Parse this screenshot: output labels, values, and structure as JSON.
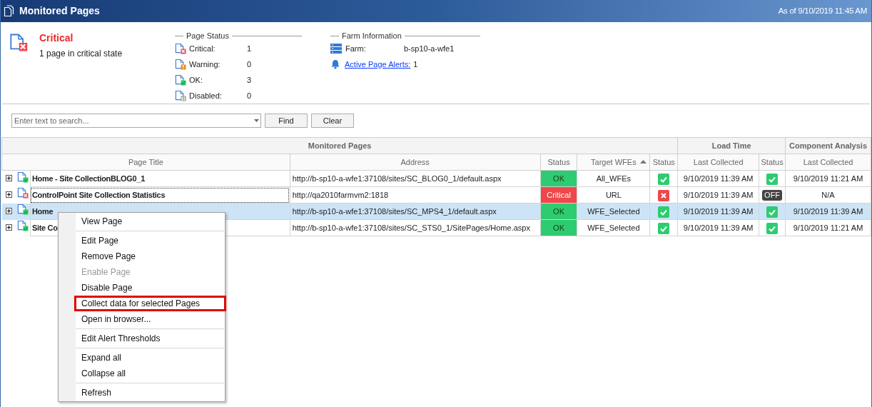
{
  "window": {
    "title": "Monitored Pages",
    "timestamp": "As of 9/10/2019 11:45 AM"
  },
  "summary": {
    "kind": "critical",
    "state": "Critical",
    "message": "1 page in critical state"
  },
  "page_status": {
    "title": "Page Status",
    "items": [
      {
        "kind": "critical",
        "label": "Critical:",
        "count": "1"
      },
      {
        "kind": "warning",
        "label": "Warning:",
        "count": "0"
      },
      {
        "kind": "ok",
        "label": "OK:",
        "count": "3"
      },
      {
        "kind": "disabled",
        "label": "Disabled:",
        "count": "0"
      }
    ]
  },
  "farm_information": {
    "title": "Farm Information",
    "farm_label": "Farm:",
    "farm_value": "b-sp10-a-wfe1",
    "alerts_link": "Active Page Alerts:",
    "alerts_count": "1"
  },
  "search": {
    "placeholder": "Enter text to search...",
    "buttons": [
      "Find",
      "Clear"
    ]
  },
  "table": {
    "group_headers": [
      "Monitored Pages",
      "Load Time",
      "Component Analysis"
    ],
    "columns": [
      {
        "label": "Page Title",
        "sorted": false
      },
      {
        "label": "Address",
        "sorted": false
      },
      {
        "label": "Status",
        "sorted": false
      },
      {
        "label": "Target WFEs",
        "sorted": true
      },
      {
        "label": "Status",
        "sorted": false
      },
      {
        "label": "Last Collected",
        "sorted": false
      },
      {
        "label": "Status",
        "sorted": false
      },
      {
        "label": "Last Collected",
        "sorted": false
      }
    ],
    "rows": [
      {
        "selected": false,
        "focused": false,
        "page_icon": {
          "kind": "ok"
        },
        "title": "Home - Site CollectionBLOG0_1",
        "address": "http://b-sp10-a-wfe1:37108/sites/SC_BLOG0_1/default.aspx",
        "status": {
          "kind": "ok",
          "text": "OK"
        },
        "target": "All_WFEs",
        "load_status": {
          "kind": "ok"
        },
        "load_last": "9/10/2019 11:39 AM",
        "component_status": {
          "kind": "ok"
        },
        "component_last": "9/10/2019 11:21 AM"
      },
      {
        "selected": false,
        "focused": true,
        "page_icon": {
          "kind": "critical"
        },
        "title": "ControlPoint Site Collection Statistics",
        "address": "http://qa2010farmvm2:1818",
        "status": {
          "kind": "critical",
          "text": "Critical"
        },
        "target": "URL",
        "load_status": {
          "kind": "error"
        },
        "load_last": "9/10/2019 11:39 AM",
        "component_status": {
          "kind": "off",
          "text": "OFF"
        },
        "component_last": "N/A"
      },
      {
        "selected": true,
        "focused": false,
        "page_icon": {
          "kind": "ok"
        },
        "title": "Home",
        "address": "http://b-sp10-a-wfe1:37108/sites/SC_MPS4_1/default.aspx",
        "status": {
          "kind": "ok",
          "text": "OK"
        },
        "target": "WFE_Selected",
        "load_status": {
          "kind": "ok"
        },
        "load_last": "9/10/2019 11:39 AM",
        "component_status": {
          "kind": "ok"
        },
        "component_last": "9/10/2019 11:39 AM"
      },
      {
        "selected": false,
        "focused": false,
        "page_icon": {
          "kind": "ok"
        },
        "title": "Site Co",
        "address": "http://b-sp10-a-wfe1:37108/sites/SC_STS0_1/SitePages/Home.aspx",
        "status": {
          "kind": "ok",
          "text": "OK"
        },
        "target": "WFE_Selected",
        "load_status": {
          "kind": "ok"
        },
        "load_last": "9/10/2019 11:39 AM",
        "component_status": {
          "kind": "ok"
        },
        "component_last": "9/10/2019 11:21 AM"
      }
    ]
  },
  "context_menu": {
    "groups": [
      [
        {
          "label": "View Page",
          "disabled": false,
          "highlighted": false
        }
      ],
      [
        {
          "label": "Edit Page",
          "disabled": false,
          "highlighted": false
        },
        {
          "label": "Remove Page",
          "disabled": false,
          "highlighted": false
        },
        {
          "label": "Enable Page",
          "disabled": true,
          "highlighted": false
        },
        {
          "label": "Disable Page",
          "disabled": false,
          "highlighted": false
        },
        {
          "label": "Collect data for selected Pages",
          "disabled": false,
          "highlighted": true
        },
        {
          "label": "Open in browser...",
          "disabled": false,
          "highlighted": false
        }
      ],
      [
        {
          "label": "Edit Alert Thresholds",
          "disabled": false,
          "highlighted": false
        }
      ],
      [
        {
          "label": "Expand all",
          "disabled": false,
          "highlighted": false
        },
        {
          "label": "Collapse all",
          "disabled": false,
          "highlighted": false
        }
      ],
      [
        {
          "label": "Refresh",
          "disabled": false,
          "highlighted": false
        }
      ]
    ]
  }
}
